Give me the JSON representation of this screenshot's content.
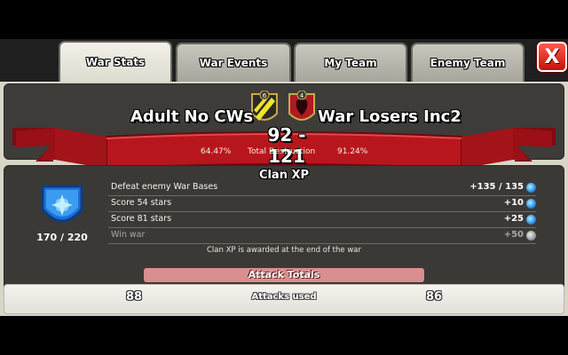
{
  "tabs": [
    {
      "label": "War Stats",
      "active": true
    },
    {
      "label": "War Events",
      "active": false
    },
    {
      "label": "My Team",
      "active": false
    },
    {
      "label": "Enemy Team",
      "active": false
    }
  ],
  "close_label": "X",
  "banner": {
    "home_clan": "Adult No CWs",
    "enemy_clan": "War Losers Inc2",
    "home_level": "6",
    "enemy_level": "4",
    "score": "92 - 121",
    "home_destruction": "64.47%",
    "destruction_label": "Total Destruction",
    "enemy_destruction": "91.24%"
  },
  "clan_xp": {
    "title": "Clan XP",
    "count": "170 / 220",
    "rows": [
      {
        "label": "Defeat enemy War Bases",
        "value": "+135 / 135",
        "achieved": true
      },
      {
        "label": "Score 54 stars",
        "value": "+10",
        "achieved": true
      },
      {
        "label": "Score 81 stars",
        "value": "+25",
        "achieved": true
      },
      {
        "label": "Win war",
        "value": "+50",
        "achieved": false
      }
    ],
    "note": "Clan XP is awarded at the end of the war"
  },
  "attack_totals": {
    "title": "Attack Totals",
    "home_attacks": "88",
    "label": "Attacks used",
    "enemy_attacks": "86"
  },
  "colors": {
    "ribbon": "#b8161d",
    "panel": "#3a3936",
    "accent_blue": "#1e8fe8"
  }
}
